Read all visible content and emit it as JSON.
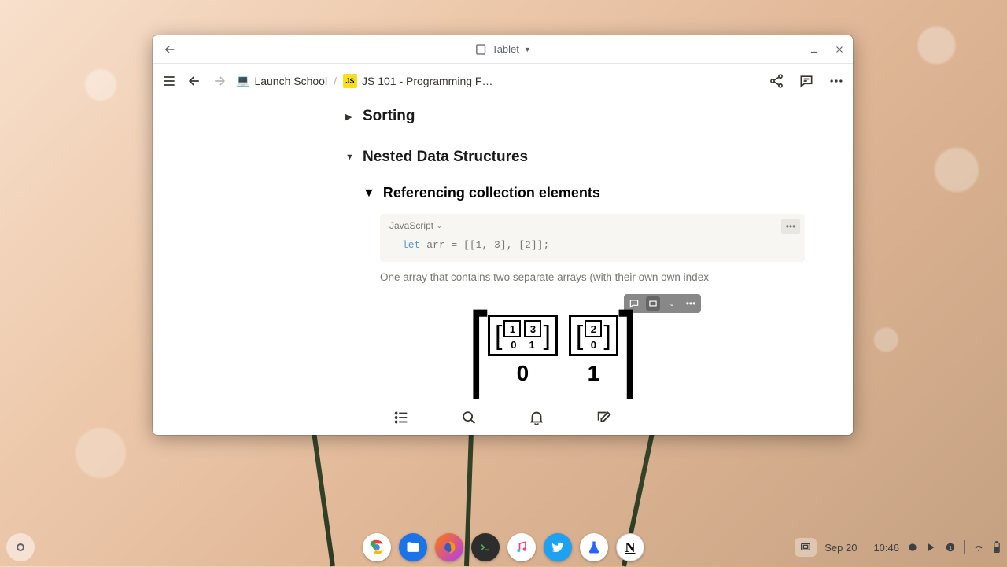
{
  "window": {
    "device_label": "Tablet"
  },
  "breadcrumb": {
    "parent": "Launch School",
    "page": "JS 101 - Programming F…",
    "js_badge": "JS"
  },
  "content": {
    "sorting_heading": "Sorting",
    "nested_heading": "Nested Data Structures",
    "ref_heading": "Referencing collection elements",
    "code_lang": "JavaScript",
    "code": {
      "kw": "let",
      "id": "arr",
      "rest": " = [[1, 3], [2]];"
    },
    "caption": "One array that contains two separate arrays (with their own own index",
    "diagram": {
      "inner0": [
        "1",
        "3"
      ],
      "inner0_idx": [
        "0",
        "1"
      ],
      "inner1": [
        "2"
      ],
      "inner1_idx": [
        "0"
      ],
      "outer_idx": [
        "0",
        "1"
      ]
    }
  },
  "shelf": {
    "date": "Sep 20",
    "time": "10:46"
  }
}
